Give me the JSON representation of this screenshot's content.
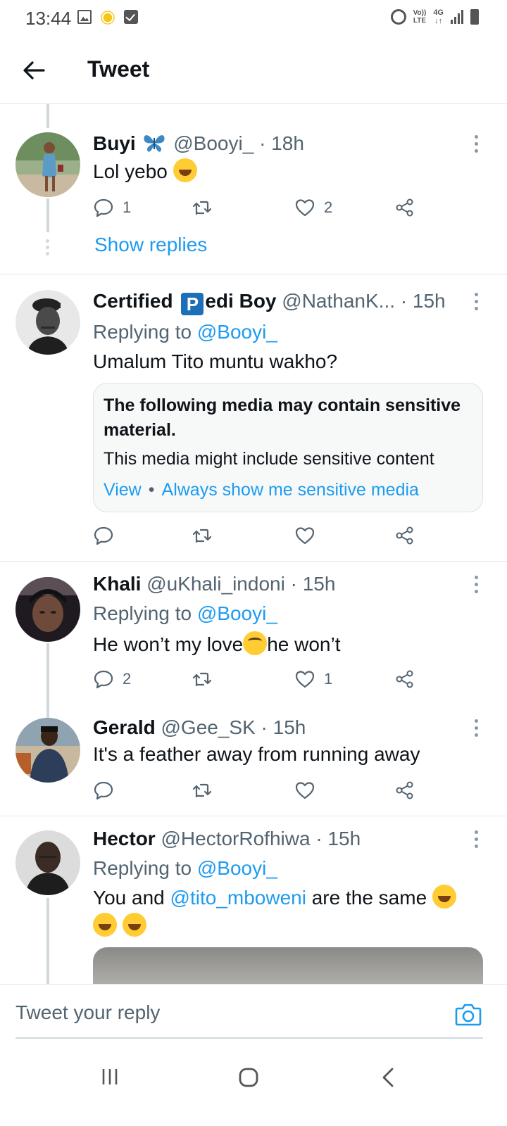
{
  "status_bar": {
    "time": "13:44",
    "volte_line1": "Vo))",
    "volte_line2": "LTE",
    "network_line1": "4G",
    "network_line2": "↓↑"
  },
  "header": {
    "title": "Tweet"
  },
  "tweets": [
    {
      "name": "Buyi",
      "name_emoji": "butterfly",
      "handle": "@Booyi_",
      "time": "· 18h",
      "text": "Lol yebo",
      "reply_count": "1",
      "like_count": "2",
      "show_replies": "Show replies"
    },
    {
      "name_part1": "Certified",
      "name_badge": "P",
      "name_part2": "edi Boy",
      "handle": "@NathanK...",
      "time": "· 15h",
      "replying_prefix": "Replying to",
      "replying_handle": "@Booyi_",
      "text": "Umalum Tito muntu wakho?",
      "sensitive": {
        "title": "The following media may contain sensitive material.",
        "subtitle": "This media might include sensitive content",
        "view": "View",
        "separator": "•",
        "always_show": "Always show me sensitive media"
      }
    },
    {
      "name": "Khali",
      "handle": "@uKhali_indoni",
      "time": "· 15h",
      "replying_prefix": "Replying to",
      "replying_handle": "@Booyi_",
      "text_part1": "He won’t my love",
      "text_part2": "he won’t",
      "reply_count": "2",
      "like_count": "1"
    },
    {
      "name": "Gerald",
      "handle": "@Gee_SK",
      "time": "· 15h",
      "text": "It's a feather away from running away"
    },
    {
      "name": "Hector",
      "handle": "@HectorRofhiwa",
      "time": "· 15h",
      "replying_prefix": "Replying to",
      "replying_handle": "@Booyi_",
      "text_part1": "You and",
      "mention": "@tito_mboweni",
      "text_part2": "are the same"
    }
  ],
  "reply_bar": {
    "placeholder": "Tweet your reply"
  },
  "colors": {
    "link": "#1d9bf0",
    "secondary_text": "#536471",
    "divider": "#e1e6ea"
  }
}
